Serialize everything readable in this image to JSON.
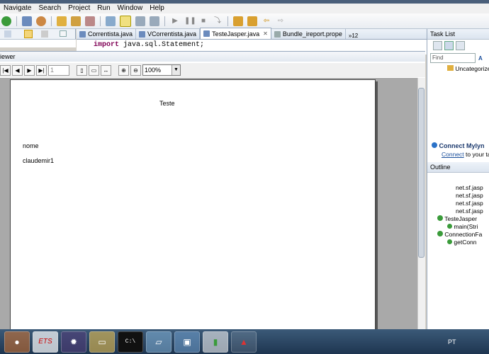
{
  "menu": [
    "Navigate",
    "Search",
    "Project",
    "Run",
    "Window",
    "Help"
  ],
  "editor_tabs": [
    {
      "label": "Correntista.java",
      "active": false
    },
    {
      "label": "VCorrentista.java",
      "active": false
    },
    {
      "label": "TesteJasper.java",
      "active": true
    },
    {
      "label": "Bundle_ireport.prope",
      "active": false
    }
  ],
  "editor_overflow": "»12",
  "code": {
    "keyword": "import",
    "text": " java.sql.Statement;"
  },
  "viewer": {
    "title": "iewer",
    "page_number": "1",
    "zoom": "100%",
    "report": {
      "title": "Teste",
      "field_label": "nome",
      "field_value": "claudemir1"
    }
  },
  "right": {
    "task_list": "Task List",
    "find_placeholder": "Find",
    "all_short": "A",
    "uncategorized": "Uncategorized",
    "mylyn_title": "Connect Mylyn",
    "mylyn_link": "Connect",
    "mylyn_rest": " to your tas",
    "outline": "Outline",
    "outline_items": [
      "net.sf.jasp",
      "net.sf.jasp",
      "net.sf.jasp",
      "net.sf.jasp",
      "TesteJasper",
      "main(Stri",
      "ConnectionFa",
      "getConn"
    ]
  },
  "taskbar": {
    "language": "PT",
    "et_label": "ETS"
  },
  "colors": {
    "keyword": "#7f0055",
    "link": "#1a4f9c",
    "taskbar": "#2a4563"
  }
}
